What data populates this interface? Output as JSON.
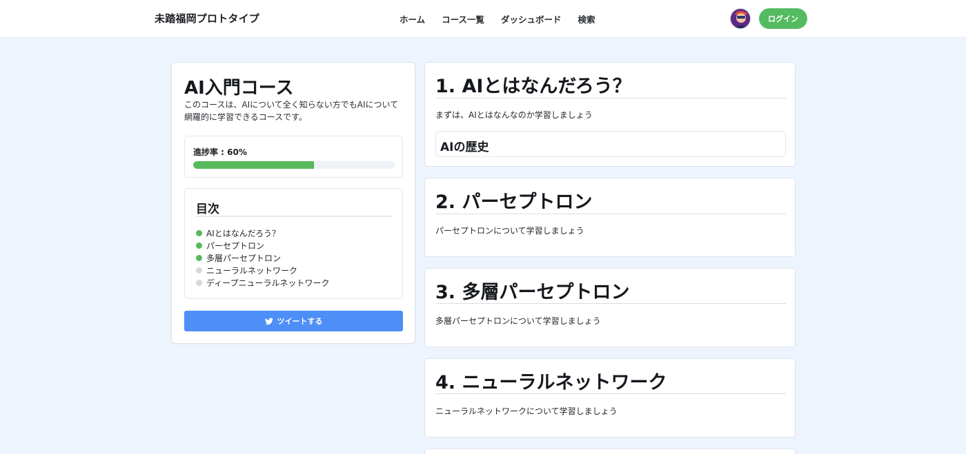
{
  "header": {
    "brand": "未踏福岡プロトタイプ",
    "nav": [
      "ホーム",
      "コース一覧",
      "ダッシュボード",
      "検索"
    ],
    "login_label": "ログイン"
  },
  "course": {
    "title": "AI入門コース",
    "description": "このコースは、AIについて全く知らない方でもAIについて網羅的に学習できるコースです。",
    "progress_label": "進捗率 : 60%",
    "progress_value": 0.6,
    "toc_title": "目次",
    "toc": [
      {
        "label": "AIとはなんだろう？",
        "done": true
      },
      {
        "label": "パーセプトロン",
        "done": true
      },
      {
        "label": "多層パーセプトロン",
        "done": true
      },
      {
        "label": "ニューラルネットワーク",
        "done": false
      },
      {
        "label": "ディープニューラルネットワーク",
        "done": false
      }
    ],
    "tweet_label": "ツイートする"
  },
  "sections": [
    {
      "title": "1. AIとはなんだろう？",
      "desc": "まずは、AIとはなんなのか学習しましょう",
      "sub_item": "AIの歴史"
    },
    {
      "title": "2. パーセプトロン",
      "desc": "パーセプトロンについて学習しましょう"
    },
    {
      "title": "3. 多層パーセプトロン",
      "desc": "多層パーセプトロンについて学習しましょう"
    },
    {
      "title": "4. ニューラルネットワーク",
      "desc": "ニューラルネットワークについて学習しましょう"
    }
  ],
  "colors": {
    "accent_green": "#54bb61",
    "tweet_blue": "#4e8ef7",
    "page_bg": "#eef4fd"
  },
  "icons": {
    "tweet": "twitter-bird-icon",
    "done": "status-dot-complete",
    "todo": "status-dot-incomplete"
  }
}
